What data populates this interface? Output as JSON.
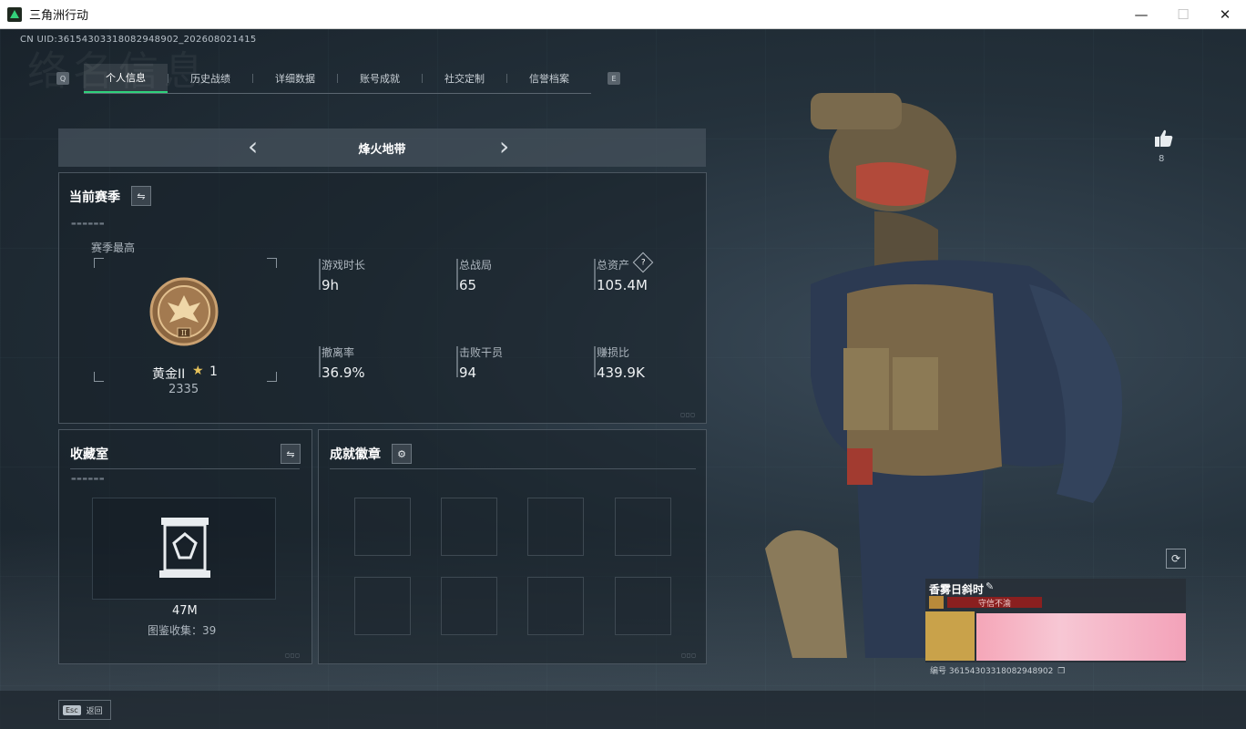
{
  "window": {
    "title": "三角洲行动",
    "minimize": "—",
    "maximize": "☐",
    "close": "✕"
  },
  "uid": "CN UID:36154303318082948902_202608021415",
  "bg_title": "络名信息",
  "tabbar": {
    "left_key": "Q",
    "right_key": "E",
    "tabs": [
      "个人信息",
      "历史战绩",
      "详细数据",
      "账号成就",
      "社交定制",
      "信誉档案"
    ],
    "active_index": 0
  },
  "mode": {
    "name": "烽火地带",
    "prev": "‹",
    "next": "›"
  },
  "season": {
    "title": "当前赛季",
    "best_label": "赛季最高",
    "rank_name": "黄金II",
    "rank_stars": "1",
    "rank_points": "2335",
    "stats": [
      {
        "label": "游戏时长",
        "value": "9h"
      },
      {
        "label": "总战局",
        "value": "65"
      },
      {
        "label": "总资产",
        "value": "105.4M",
        "help": "?"
      },
      {
        "label": "撤离率",
        "value": "36.9%"
      },
      {
        "label": "击败干员",
        "value": "94"
      },
      {
        "label": "赚损比",
        "value": "439.9K"
      }
    ]
  },
  "collection": {
    "title": "收藏室",
    "value": "47M",
    "caption": "图鉴收集：39"
  },
  "badges": {
    "title": "成就徽章"
  },
  "profile": {
    "likes": "8",
    "name": "香雾日斜时",
    "tag": "守信不渝",
    "id": "编号 36154303318082948902"
  },
  "bottom": {
    "esc_key": "Esc",
    "esc_label": "返回"
  },
  "colors": {
    "accent": "#2fd27b",
    "panel_border": "#4b5660",
    "tag_red": "#8a1f1f"
  }
}
